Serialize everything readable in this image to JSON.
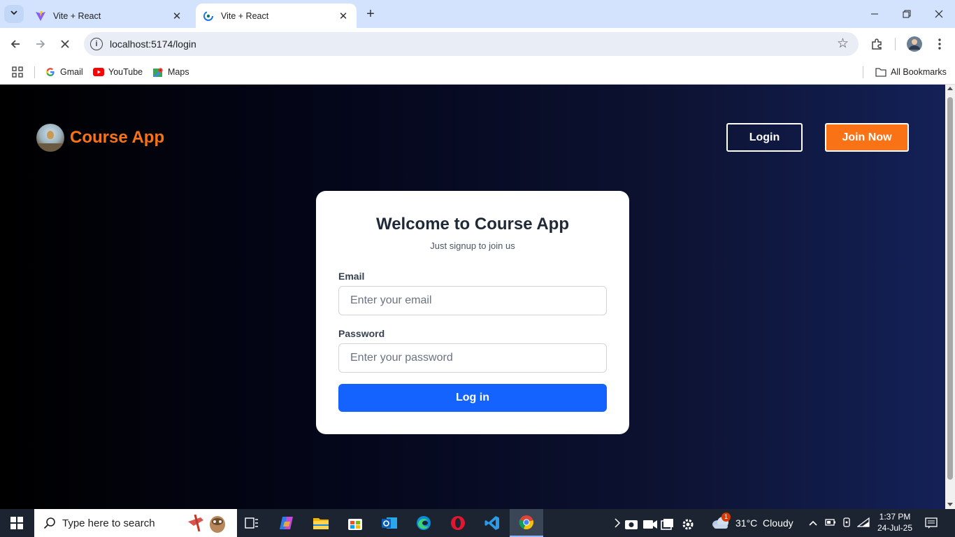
{
  "browser": {
    "tabs": [
      {
        "title": "Vite + React",
        "active": false
      },
      {
        "title": "Vite + React",
        "active": true
      }
    ],
    "url": "localhost:5174/login",
    "bookmarks": [
      {
        "label": "Gmail",
        "icon": "gmail-icon"
      },
      {
        "label": "YouTube",
        "icon": "youtube-icon"
      },
      {
        "label": "Maps",
        "icon": "maps-icon"
      }
    ],
    "all_bookmarks_label": "All Bookmarks"
  },
  "header": {
    "brand": "Course App",
    "login_label": "Login",
    "join_label": "Join Now"
  },
  "login_card": {
    "title": "Welcome to Course App",
    "subtitle": "Just signup to join us",
    "email_label": "Email",
    "email_placeholder": "Enter your email",
    "password_label": "Password",
    "password_placeholder": "Enter your password",
    "submit_label": "Log in"
  },
  "taskbar": {
    "search_placeholder": "Type here to search",
    "weather": "31°C  Cloudy",
    "weather_badge": "1",
    "time": "1:37 PM",
    "date": "24-Jul-25"
  },
  "colors": {
    "accent_orange": "#f97316",
    "button_blue": "#1463ff",
    "page_bg_start": "#000000",
    "page_bg_end": "#142157"
  }
}
